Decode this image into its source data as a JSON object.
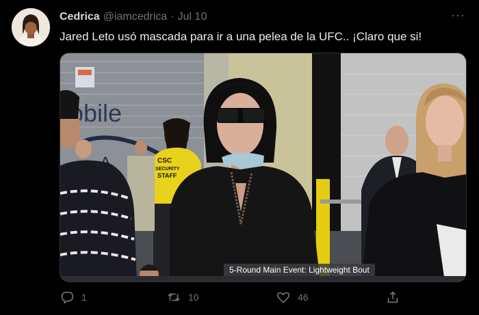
{
  "tweet": {
    "author": {
      "name": "Cedrica",
      "handle": "@iamcedrica",
      "date": "Jul 10"
    },
    "separator": "·",
    "more_label": "···",
    "text": "Jared Leto usó mascada para ir a una pelea de la UFC.. ¡Claro que si!",
    "media": {
      "caption": "5-Round Main Event: Lightweight Bout",
      "sign_text": "obile",
      "vest_text": [
        "CSC",
        "SECURITY",
        "STAFF"
      ]
    },
    "actions": {
      "reply_count": "1",
      "retweet_count": "10",
      "like_count": "46"
    },
    "icons": {
      "reply": "reply-icon",
      "retweet": "retweet-icon",
      "like": "heart-icon",
      "share": "share-icon",
      "more": "more-options-icon"
    },
    "colors": {
      "background": "#000000",
      "secondary_text": "#6e767d",
      "primary_text": "#d9d9d9"
    }
  }
}
